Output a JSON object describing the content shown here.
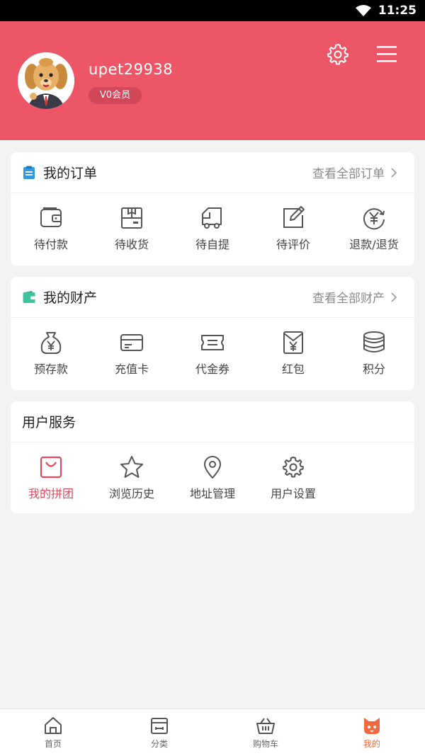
{
  "status_bar": {
    "time": "11:25"
  },
  "profile": {
    "username": "upet29938",
    "member_level": "V0会员"
  },
  "orders": {
    "title": "我的订单",
    "more": "查看全部订单",
    "items": [
      {
        "label": "待付款",
        "icon": "wallet-icon"
      },
      {
        "label": "待收货",
        "icon": "box-icon"
      },
      {
        "label": "待自提",
        "icon": "truck-icon"
      },
      {
        "label": "待评价",
        "icon": "edit-icon"
      },
      {
        "label": "退款/退货",
        "icon": "refund-icon"
      }
    ]
  },
  "assets": {
    "title": "我的财产",
    "more": "查看全部财产",
    "items": [
      {
        "label": "预存款",
        "icon": "money-bag-icon"
      },
      {
        "label": "充值卡",
        "icon": "card-icon"
      },
      {
        "label": "代金券",
        "icon": "ticket-icon"
      },
      {
        "label": "红包",
        "icon": "red-packet-icon"
      },
      {
        "label": "积分",
        "icon": "coins-icon"
      }
    ]
  },
  "services": {
    "title": "用户服务",
    "items": [
      {
        "label": "我的拼团",
        "icon": "bag-icon"
      },
      {
        "label": "浏览历史",
        "icon": "star-icon"
      },
      {
        "label": "地址管理",
        "icon": "location-icon"
      },
      {
        "label": "用户设置",
        "icon": "gear-icon"
      }
    ]
  },
  "nav": [
    {
      "label": "首页",
      "icon": "home-icon"
    },
    {
      "label": "分类",
      "icon": "category-icon"
    },
    {
      "label": "购物车",
      "icon": "cart-icon"
    },
    {
      "label": "我的",
      "icon": "cat-face-icon"
    }
  ],
  "colors": {
    "header": "#ec5667",
    "active_service": "#e8475b",
    "active_nav": "#f2683f"
  }
}
